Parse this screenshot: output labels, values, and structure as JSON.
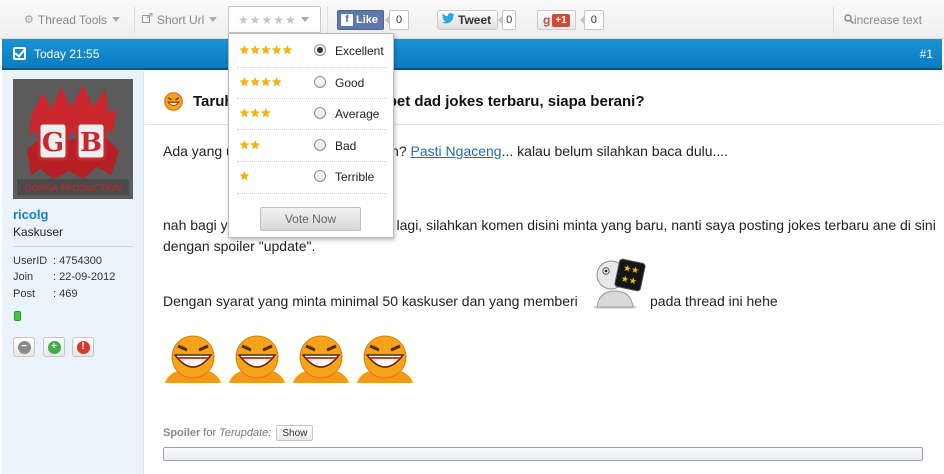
{
  "toolbar": {
    "thread_tools_label": "Thread Tools",
    "short_url_label": "Short Url",
    "rating_stars": "★★★★★",
    "facebook_like_label": "Like",
    "facebook_count": "0",
    "tweet_label": "Tweet",
    "tweet_count": "0",
    "gplus_g": "g",
    "gplus_label": "+1",
    "gplus_count": "0",
    "increase_text_label": "increase text",
    "icons": {
      "thread_tools": "gear-icon",
      "short_url": "share-icon",
      "increase_text": "zoom-icon"
    }
  },
  "rating_menu": {
    "options": [
      {
        "stars": "★★★★★",
        "label": "Excellent",
        "selected": true
      },
      {
        "stars": "★★★★",
        "label": "Good",
        "selected": false
      },
      {
        "stars": "★★★",
        "label": "Average",
        "selected": false
      },
      {
        "stars": "★★",
        "label": "Bad",
        "selected": false
      },
      {
        "stars": "★",
        "label": "Terrible",
        "selected": false
      }
    ],
    "vote_button_label": "Vote Now"
  },
  "post": {
    "time": "Today 21:55",
    "number": "#1",
    "title": "Taruh di thread ini, pasti dapet dad jokes terbaru, siapa berani?",
    "paragraph1_pre": "Ada yang udah baca thread jokes gan? ",
    "paragraph1_link": "Pasti Ngaceng",
    "paragraph1_post": "... kalau belum silahkan baca dulu....",
    "paragraph2_line1": "nah bagi yang sudah baca dan minta lagi, silahkan komen disini minta yang baru, nanti saya posting jokes terbaru ane di sini",
    "paragraph2_line2": "dengan spoiler \"update\".",
    "paragraph3_pre": "Dengan syarat yang minta minimal 50 kaskuser dan yang memberi",
    "paragraph3_post": "pada thread ini hehe",
    "spoiler_keyword": "Spoiler",
    "spoiler_for": "for",
    "spoiler_title": "Terupdate:",
    "spoiler_show_label": "Show"
  },
  "user": {
    "avatar_text": "GORGA PRODUCTION",
    "name": "ricolg",
    "title": "Kaskuser",
    "stats": [
      {
        "key": "UserID",
        "value": ": 4754300"
      },
      {
        "key": "Join",
        "value": ": 22-09-2012"
      },
      {
        "key": "Post",
        "value": ": 469"
      }
    ]
  },
  "colors": {
    "post_bar": "#0b7cc0",
    "username": "#1f7cc4",
    "link": "#1d6fb3",
    "star_gold": "#f2b600"
  }
}
